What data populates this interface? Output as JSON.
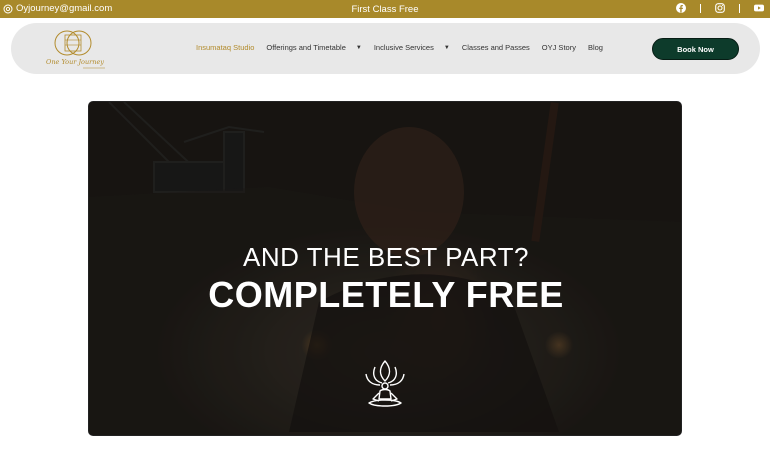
{
  "topbar": {
    "email": "Oyjourney@gmail.com",
    "promo": "First Class Free",
    "socials": [
      "facebook-icon",
      "instagram-icon",
      "youtube-icon"
    ],
    "background": "#a8892a"
  },
  "header": {
    "logo_text": "One Your Journey",
    "nav": [
      {
        "label": "Insumataq Studio",
        "active": true,
        "dropdown": false
      },
      {
        "label": "Offerings and Timetable",
        "active": false,
        "dropdown": true
      },
      {
        "label": "Inclusive Services",
        "active": false,
        "dropdown": true
      },
      {
        "label": "Classes and Passes",
        "active": false,
        "dropdown": false
      },
      {
        "label": "OYJ Story",
        "active": false,
        "dropdown": false
      },
      {
        "label": "Blog",
        "active": false,
        "dropdown": false
      }
    ],
    "book_label": "Book Now",
    "accent": "#b28b2c",
    "button_color": "#0d3b2b"
  },
  "hero": {
    "line1": "AND THE BEST PART?",
    "line2": "COMPLETELY FREE",
    "icon": "meditation-lotus-icon"
  }
}
